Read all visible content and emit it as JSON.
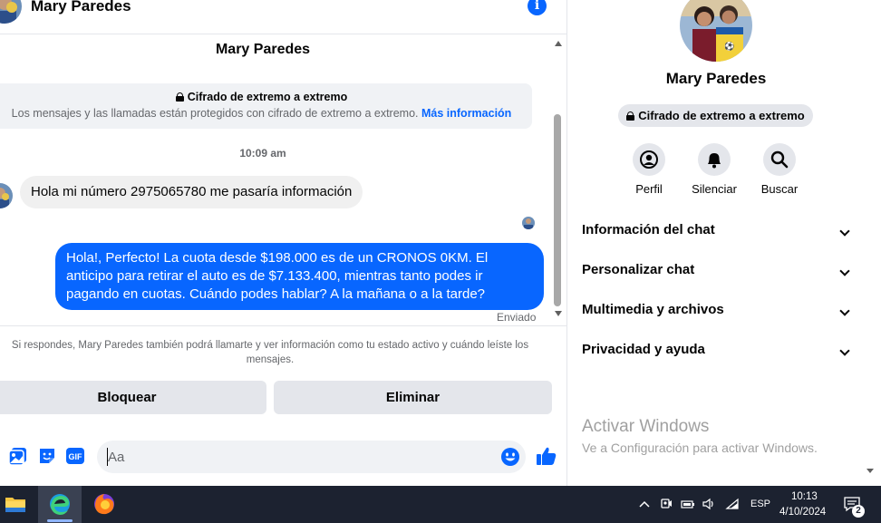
{
  "chat_header": {
    "name": "Mary Paredes",
    "info_icon": "info-icon"
  },
  "conversation": {
    "title": "Mary Paredes",
    "e2e_notice": {
      "title": "Cifrado de extremo a extremo",
      "text": "Los mensajes y las llamadas están protegidos con cifrado de extremo a extremo.",
      "link": "Más información"
    },
    "timestamp": "10:09 am",
    "messages": [
      {
        "direction": "incoming",
        "text": "Hola mi número 2975065780 me pasaría información"
      },
      {
        "direction": "outgoing",
        "text": "Hola!, Perfecto! La cuota desde $198.000 es de un CRONOS 0KM. El anticipo para retirar el auto es de $7.133.400, mientras tanto podes ir pagando en cuotas. Cuándo podes hablar? A la mañana o a la tarde?"
      }
    ],
    "sent_status": "Enviado"
  },
  "notice": "Si respondes, Mary Paredes también podrá llamarte y ver información como tu estado activo y cuándo leíste los mensajes.",
  "buttons": {
    "block": "Bloquear",
    "delete": "Eliminar"
  },
  "composer": {
    "placeholder": "Aa",
    "icons": [
      "photo-icon",
      "sticker-icon",
      "gif-icon",
      "emoji-icon",
      "like-icon"
    ],
    "gif_label": "GIF"
  },
  "info_panel": {
    "name": "Mary Paredes",
    "e2e_badge": "Cifrado de extremo a extremo",
    "actions": [
      {
        "label": "Perfil",
        "icon": "profile-icon"
      },
      {
        "label": "Silenciar",
        "icon": "bell-icon"
      },
      {
        "label": "Buscar",
        "icon": "search-icon"
      }
    ],
    "sections": [
      "Información del chat",
      "Personalizar chat",
      "Multimedia y archivos",
      "Privacidad y ayuda"
    ]
  },
  "watermark": {
    "title": "Activar Windows",
    "subtitle": "Ve a Configuración para activar Windows."
  },
  "taskbar": {
    "apps": [
      "file-explorer-icon",
      "edge-icon",
      "firefox-icon"
    ],
    "language": "ESP",
    "time": "10:13",
    "date": "4/10/2024",
    "notifications": "2"
  },
  "colors": {
    "accent": "#0866ff",
    "bubble_in": "#f0f0f0",
    "taskbar": "#1c2230"
  }
}
